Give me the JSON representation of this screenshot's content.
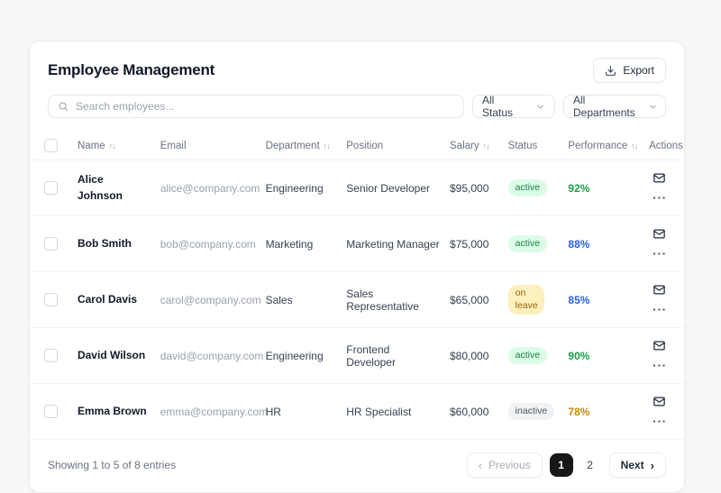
{
  "page": {
    "title": "Employee Management"
  },
  "header": {
    "export_label": "Export"
  },
  "toolbar": {
    "search_placeholder": "Search employees...",
    "status_filter_value": "All Status",
    "department_filter_value": "All Departments"
  },
  "icons": {
    "sort": "↑↓",
    "ellipsis": "···",
    "chevron_left": "‹",
    "chevron_right": "›"
  },
  "colors": {
    "badge_active_bg": "#dcfce7",
    "badge_active_text": "#15803d",
    "badge_on_leave_bg": "#fcf0bd",
    "badge_on_leave_text": "#a16207",
    "badge_inactive_bg": "#f1f2f4",
    "badge_inactive_text": "#4b5563",
    "perf_green": "#16a34a",
    "perf_blue": "#2563eb",
    "perf_yellow": "#ca8a04",
    "active_page_bg": "#18181b"
  },
  "table": {
    "columns": [
      {
        "key": "checkbox",
        "label": "",
        "sortable": false
      },
      {
        "key": "name",
        "label": "Name",
        "sortable": true
      },
      {
        "key": "email",
        "label": "Email",
        "sortable": false
      },
      {
        "key": "department",
        "label": "Department",
        "sortable": true
      },
      {
        "key": "position",
        "label": "Position",
        "sortable": false
      },
      {
        "key": "salary",
        "label": "Salary",
        "sortable": true
      },
      {
        "key": "status",
        "label": "Status",
        "sortable": false
      },
      {
        "key": "performance",
        "label": "Performance",
        "sortable": true
      },
      {
        "key": "actions",
        "label": "Actions",
        "sortable": false
      }
    ],
    "rows": [
      {
        "name": "Alice Johnson",
        "email": "alice@company.com",
        "department": "Engineering",
        "position": "Senior Developer",
        "salary": "$95,000",
        "status": "active",
        "status_class": "active",
        "performance": "92%",
        "perf_class": "green"
      },
      {
        "name": "Bob Smith",
        "email": "bob@company.com",
        "department": "Marketing",
        "position": "Marketing Manager",
        "salary": "$75,000",
        "status": "active",
        "status_class": "active",
        "performance": "88%",
        "perf_class": "blue"
      },
      {
        "name": "Carol Davis",
        "email": "carol@company.com",
        "department": "Sales",
        "position": "Sales Representative",
        "salary": "$65,000",
        "status": "on leave",
        "status_class": "on-leave",
        "performance": "85%",
        "perf_class": "blue"
      },
      {
        "name": "David Wilson",
        "email": "david@company.com",
        "department": "Engineering",
        "position": "Frontend Developer",
        "salary": "$80,000",
        "status": "active",
        "status_class": "active",
        "performance": "90%",
        "perf_class": "green"
      },
      {
        "name": "Emma Brown",
        "email": "emma@company.com",
        "department": "HR",
        "position": "HR Specialist",
        "salary": "$60,000",
        "status": "inactive",
        "status_class": "inactive",
        "performance": "78%",
        "perf_class": "yellow"
      }
    ]
  },
  "footer": {
    "summary": "Showing 1 to 5 of 8 entries",
    "pagination": {
      "prev_label": "Previous",
      "next_label": "Next",
      "pages": [
        "1",
        "2"
      ],
      "active_page": "1"
    }
  }
}
